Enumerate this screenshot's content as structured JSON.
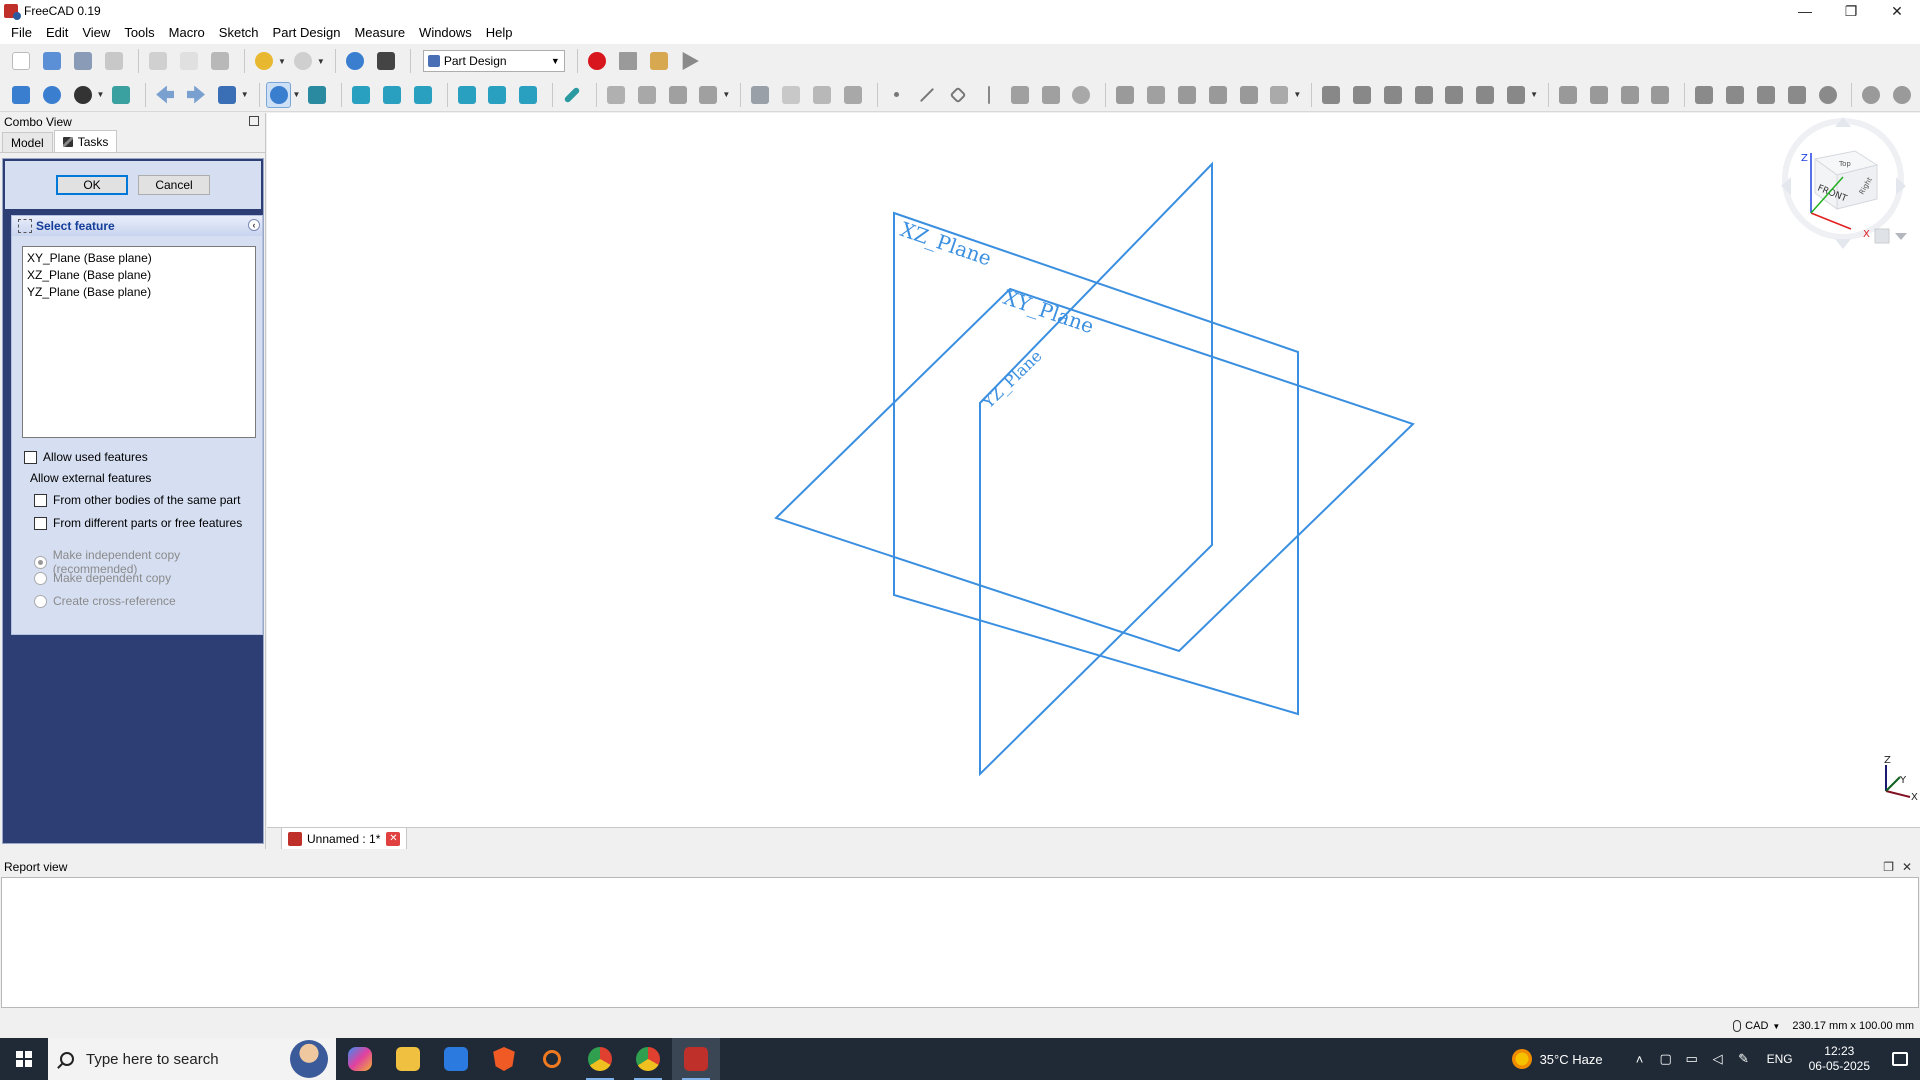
{
  "window": {
    "title": "FreeCAD 0.19",
    "minimize": "—",
    "restore": "❐",
    "close": "✕"
  },
  "menu": [
    "File",
    "Edit",
    "View",
    "Tools",
    "Macro",
    "Sketch",
    "Part Design",
    "Measure",
    "Windows",
    "Help"
  ],
  "workbench": {
    "selected": "Part Design"
  },
  "combo_view": {
    "title": "Combo View",
    "tabs": [
      {
        "label": "Model"
      },
      {
        "label": "Tasks"
      }
    ],
    "ok_label": "OK",
    "cancel_label": "Cancel",
    "select_feature": {
      "title": "Select feature",
      "features": [
        "XY_Plane (Base plane)",
        "XZ_Plane (Base plane)",
        "YZ_Plane (Base plane)"
      ],
      "allow_used": "Allow used features",
      "allow_external": "Allow external features",
      "from_other_bodies": "From other bodies of the same part",
      "from_different_parts": "From different parts or free features",
      "make_independent": "Make independent copy (recommended)",
      "make_dependent": "Make dependent copy",
      "create_cross_ref": "Create cross-reference"
    }
  },
  "viewport": {
    "plane_labels": {
      "xz": "XZ_Plane",
      "xy": "XY_Plane",
      "yz": "YZ_Plane"
    },
    "navcube": {
      "top": "Top",
      "front": "FRONT",
      "right": "Right"
    },
    "axes": {
      "x": "X",
      "y": "Y",
      "z": "Z"
    },
    "plane_color": "#3a8fe0"
  },
  "document_tab": {
    "label": "Unnamed : 1*",
    "close": "✕"
  },
  "report_view": {
    "title": "Report view"
  },
  "status_bar": {
    "nav_style": "CAD",
    "dimensions": "230.17 mm x 100.00 mm"
  },
  "taskbar": {
    "search_placeholder": "Type here to search",
    "weather": "35°C  Haze",
    "language": "ENG",
    "time": "12:23",
    "date": "06-05-2025"
  }
}
